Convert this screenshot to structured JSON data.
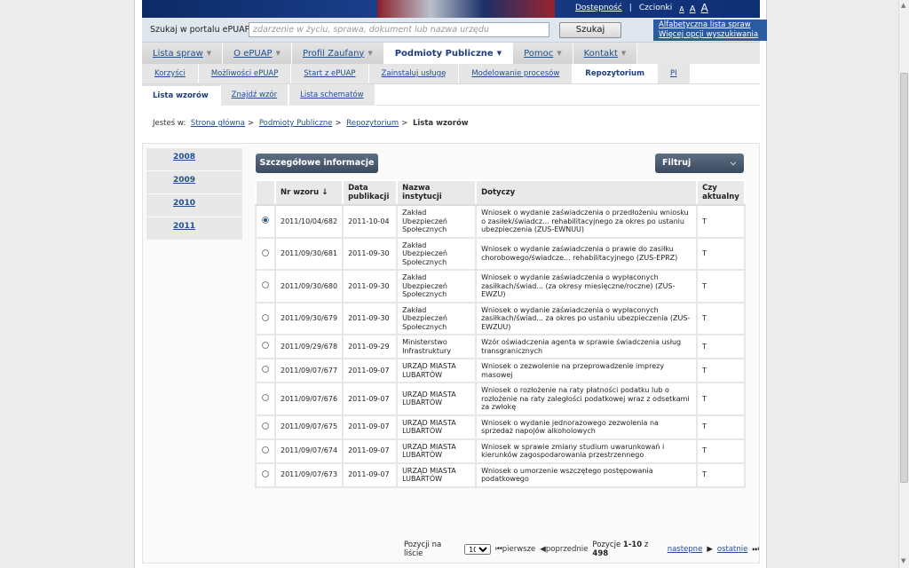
{
  "header": {
    "accessibility_link": "Dostępność",
    "separator": "|",
    "fonts_label": "Czcionki",
    "font_sizes": [
      "A",
      "A",
      "A"
    ]
  },
  "search": {
    "label": "Szukaj w portalu ePUAP",
    "placeholder": "zdarzenie w życiu, sprawa, dokument lub nazwa urzędu",
    "button": "Szukaj",
    "links": [
      "Alfabetyczna lista spraw",
      "Więcej opcji wyszukiwania"
    ]
  },
  "main_nav": [
    {
      "label": "Lista spraw",
      "active": false
    },
    {
      "label": "O ePUAP",
      "active": false
    },
    {
      "label": "Profil Zaufany",
      "active": false
    },
    {
      "label": "Podmioty Publiczne",
      "active": true
    },
    {
      "label": "Pomoc",
      "active": false
    },
    {
      "label": "Kontakt",
      "active": false
    }
  ],
  "sub_nav": [
    {
      "label": "Korzyści",
      "active": false
    },
    {
      "label": "Możliwości ePUAP",
      "active": false
    },
    {
      "label": "Start z ePUAP",
      "active": false
    },
    {
      "label": "Zainstaluj usługę",
      "active": false
    },
    {
      "label": "Modelowanie procesów",
      "active": false
    },
    {
      "label": "Repozytorium",
      "active": true
    },
    {
      "label": "PI",
      "active": false
    }
  ],
  "tabs": [
    {
      "label": "Lista wzorów",
      "active": true
    },
    {
      "label": "Znajdź wzór",
      "active": false
    },
    {
      "label": "Lista schematów",
      "active": false
    }
  ],
  "breadcrumb": {
    "prefix": "Jesteś w:",
    "sep": ">",
    "items": [
      "Strona główna",
      "Podmioty Publiczne",
      "Repozytorium"
    ],
    "current": "Lista wzorów"
  },
  "years": [
    "2008",
    "2009",
    "2010",
    "2011"
  ],
  "buttons": {
    "details": "Szczegółowe informacje",
    "filter": "Filtruj",
    "sort_arrow": "↓"
  },
  "table": {
    "headers": [
      "Nr wzoru",
      "Data publikacji",
      "Nazwa instytucji",
      "Dotyczy",
      "Czy aktualny"
    ],
    "rows": [
      {
        "selected": true,
        "nr": "2011/10/04/682",
        "date": "2011-10-04",
        "inst": "Zakład Ubezpieczeń Społecznych",
        "subject": "Wniosek o wydanie zaświadczenia o przedłożeniu wniosku o zasiłek/świadcz... rehabilitacyjnego za okres po ustaniu ubezpieczenia (ZUS-EWNUU)",
        "current": "T"
      },
      {
        "selected": false,
        "nr": "2011/09/30/681",
        "date": "2011-09-30",
        "inst": "Zakład Ubezpieczeń Społecznych",
        "subject": "Wniosek o wydanie zaświadczenia o prawie do zasiłku chorobowego/świadcze... rehabilitacyjnego (ZUS-EPRZ)",
        "current": "T"
      },
      {
        "selected": false,
        "nr": "2011/09/30/680",
        "date": "2011-09-30",
        "inst": "Zakład Ubezpieczeń Społecznych",
        "subject": "Wniosek o wydanie zaświadczenia o wypłaconych zasiłkach/świad... (za okresy miesięczne/roczne) (ZUS-EWZU)",
        "current": "T"
      },
      {
        "selected": false,
        "nr": "2011/09/30/679",
        "date": "2011-09-30",
        "inst": "Zakład Ubezpieczeń Społecznych",
        "subject": "Wniosek o wydanie zaświadczenia o wypłaconych zasiłkach/świad... za okres po ustaniu ubezpieczenia (ZUS-EWZUU)",
        "current": "T"
      },
      {
        "selected": false,
        "nr": "2011/09/29/678",
        "date": "2011-09-29",
        "inst": "Ministerstwo Infrastruktury",
        "subject": "Wzór oświadczenia agenta w sprawie świadczenia usług transgranicznych",
        "current": "T"
      },
      {
        "selected": false,
        "nr": "2011/09/07/677",
        "date": "2011-09-07",
        "inst": "URZĄD MIASTA LUBARTÓW",
        "subject": "Wniosek o zezwolenie na przeprowadzenie imprezy masowej",
        "current": "T"
      },
      {
        "selected": false,
        "nr": "2011/09/07/676",
        "date": "2011-09-07",
        "inst": "URZĄD MIASTA LUBARTÓW",
        "subject": "Wniosek o rozłożenie na raty płatności podatku lub o rozłożenie na raty zaległości podatkowej wraz z odsetkami za zwłokę",
        "current": "T"
      },
      {
        "selected": false,
        "nr": "2011/09/07/675",
        "date": "2011-09-07",
        "inst": "URZĄD MIASTA LUBARTÓW",
        "subject": "Wniosek o wydanie jednorazowego zezwolenia na sprzedaż napojów alkoholowych",
        "current": "T"
      },
      {
        "selected": false,
        "nr": "2011/09/07/674",
        "date": "2011-09-07",
        "inst": "URZĄD MIASTA LUBARTÓW",
        "subject": "Wniosek w sprawie zmiany studium uwarunkowań i kierunków zagospodarowania przestrzennego",
        "current": "T"
      },
      {
        "selected": false,
        "nr": "2011/09/07/673",
        "date": "2011-09-07",
        "inst": "URZĄD MIASTA LUBARTÓW",
        "subject": "Wniosek o umorzenie wszczętego postępowania podatkowego",
        "current": "T"
      }
    ]
  },
  "pager": {
    "per_page_label": "Pozycji na liście",
    "per_page_value": "10",
    "first": "pierwsze",
    "prev": "poprzednie",
    "range_label": "Pozycje",
    "range": "1-10",
    "of": "z",
    "total": "498",
    "next": "nastepne",
    "last": "ostatnie"
  }
}
